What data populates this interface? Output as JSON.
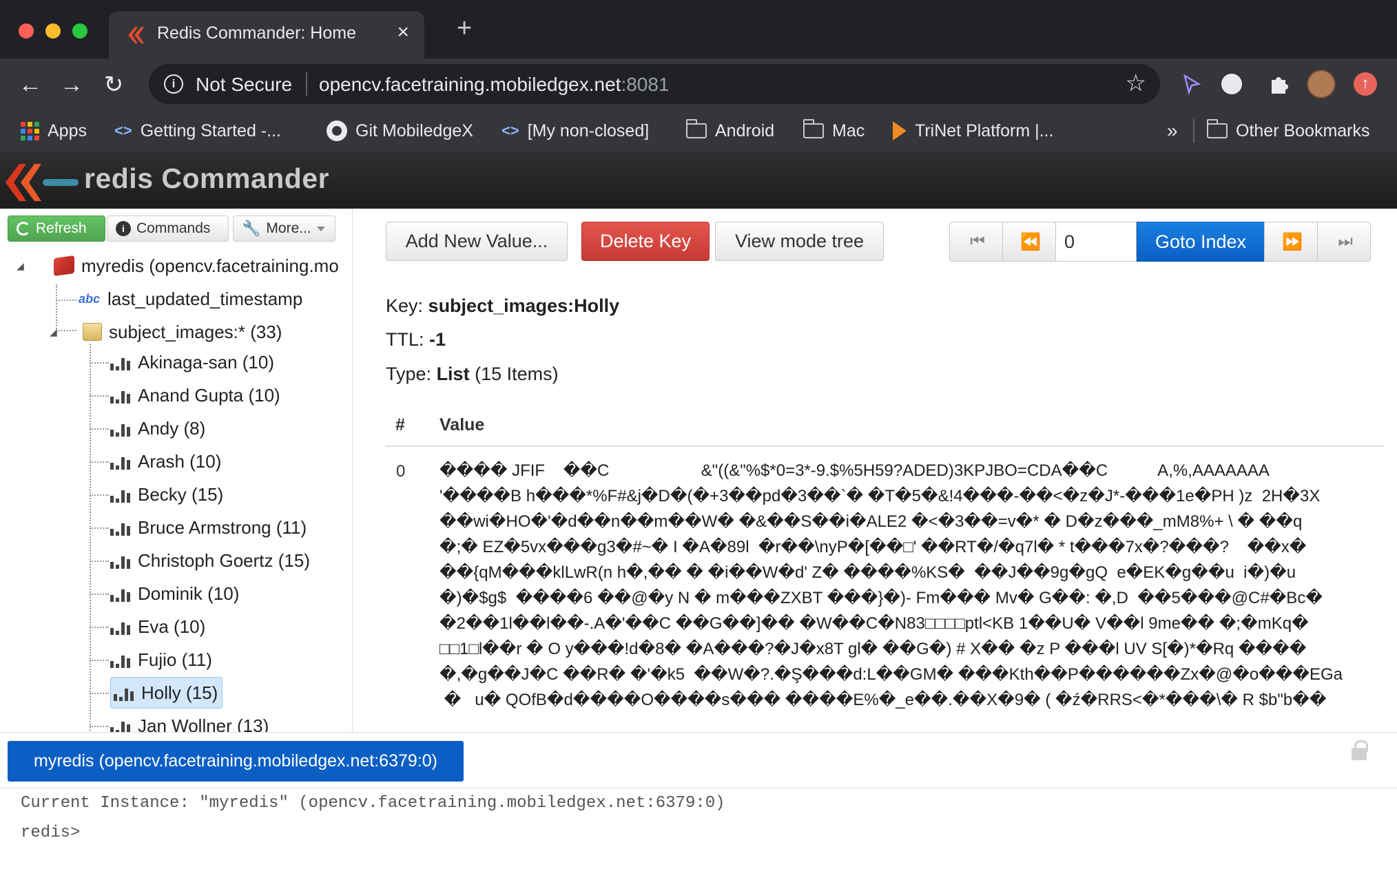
{
  "browser": {
    "tab_title": "Redis Commander: Home",
    "tab_close": "×",
    "new_tab": "+",
    "security_label": "Not Secure",
    "url_host": "opencv.facetraining.mobiledgex.net",
    "url_port": ":8081",
    "bookmarks": [
      {
        "label": "Apps",
        "icon": "apps-grid-icon"
      },
      {
        "label": "Getting Started -...",
        "icon": "link-icon"
      },
      {
        "label": "Git MobiledgeX",
        "icon": "github-icon"
      },
      {
        "label": "[My non-closed]",
        "icon": "link-icon"
      },
      {
        "label": "Android",
        "icon": "folder-icon"
      },
      {
        "label": "Mac",
        "icon": "folder-icon"
      },
      {
        "label": "TriNet Platform |...",
        "icon": "trinet-icon"
      }
    ],
    "more_bookmarks": "»",
    "other_bookmarks": "Other Bookmarks"
  },
  "app": {
    "title": "redis Commander"
  },
  "sidebar": {
    "refresh_label": "Refresh",
    "commands_label": "Commands",
    "more_label": "More...",
    "root": "myredis (opencv.facetraining.mo",
    "items": [
      {
        "label": "last_updated_timestamp",
        "type": "string"
      },
      {
        "label": "subject_images:* (33)",
        "type": "folder"
      }
    ],
    "subjects": [
      "Akinaga-san (10)",
      "Anand Gupta (10)",
      "Andy (8)",
      "Arash (10)",
      "Becky (15)",
      "Bruce Armstrong (11)",
      "Christoph Goertz (15)",
      "Dominik (10)",
      "Eva (10)",
      "Fujio (11)",
      "Holly (15)",
      "Jan Wollner (13)"
    ],
    "selected_index": 10
  },
  "toolbar": {
    "add_value": "Add New Value...",
    "delete_key": "Delete Key",
    "view_mode": "View mode tree",
    "index_value": "0",
    "goto_index": "Goto Index",
    "first_icon": "⏮",
    "prev_icon": "⏪",
    "next_icon": "⏩",
    "last_icon": "⏭"
  },
  "key_info": {
    "key_label": "Key:",
    "key_value": "subject_images:Holly",
    "ttl_label": "TTL:",
    "ttl_value": "-1",
    "type_label": "Type:",
    "type_value": "List",
    "type_count": "(15 Items)"
  },
  "table": {
    "col_index": "#",
    "col_value": "Value",
    "row_index": "0",
    "value_lines": [
      "���� JFIF    ��C                    &\"((&\"%$*0=3*-9.$%5H59?ADED)3KPJBO=CDA��C           A,%,AAAAAAA",
      "'����B h���*%F#&j�D�(�+3��pd�3��`� �T�5�&!4���-��<�z�J*-���1e�PH )z  2H�3X",
      "��wi�HO�'�d��n��m��W� �&��S��i�ALE2 �<�3��=v�* � D�z���_mM8%+ \\ � ��q",
      "�;� EZ�5vx���g3�#~� I �A�89l  �r��\\nyP�[��□' ��RT�/�q7l� * t���7x�?���?    ��x�",
      "��{qM���klLwR(n h�,�� � �i��W�d' Z� ����%KS�  ��J��9g�gQ  e�EK�g��u  i�)�u",
      "�)�$g$  ����6 ��@�y N � m���ZXBT ���}�)- Fm��� Mv� G��: �,D  ��5���@C#�Bc�",
      "�2��1l��l��-.A�'��C ��G��]�� �W��C�N83□□□□ptl<KB 1��U� V��l 9me�� �;�mKq�",
      "□□1□l��r � O y���!d�8� �A���?�J�x8T gl� ��G�) # X�� �z P ���l UV S[�)*�Rq ����",
      "�,�g��J�C ��R� �'�k5  ��W�?.�Ş���d:L��GM� ���Kth��P������Zx�@�o���EGa",
      " �   u� QOfB�d����O����s��� ����E%�_e��.��X�9� ( �ź�RRS<�*���\\� R $b\"b��"
    ]
  },
  "connection": {
    "label": "myredis (opencv.facetraining.mobiledgex.net:6379:0)"
  },
  "console": {
    "line1": "Current Instance: \"myredis\" (opencv.facetraining.mobiledgex.net:6379:0)",
    "prompt": "redis>"
  }
}
